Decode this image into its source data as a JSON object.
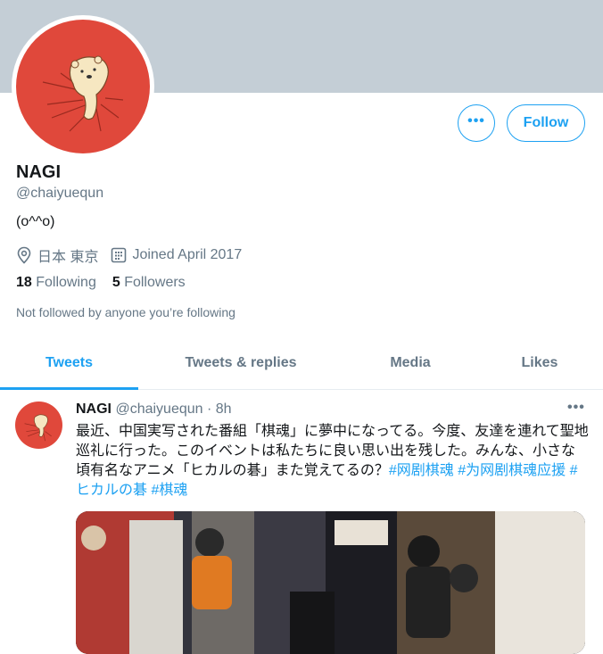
{
  "profile": {
    "name": "NAGI",
    "handle": "@chaiyuequn",
    "bio": "(o^^o)",
    "location": "日本 東京",
    "joined": "Joined April 2017",
    "following_count": "18",
    "following_label": "Following",
    "followers_count": "5",
    "followers_label": "Followers",
    "not_followed_note": "Not followed by anyone you’re following"
  },
  "actions": {
    "more_label": "•••",
    "follow_label": "Follow"
  },
  "tabs": [
    {
      "label": "Tweets",
      "active": true
    },
    {
      "label": "Tweets & replies"
    },
    {
      "label": "Media"
    },
    {
      "label": "Likes"
    }
  ],
  "tweet": {
    "name": "NAGI",
    "handle": "@chaiyuequn",
    "dot": "·",
    "time": "8h",
    "more_label": "•••",
    "text": "最近、中国実写された番組「棋魂」に夢中になってる。今度、友達を連れて聖地巡礼に行った。このイベントは私たちに良い思い出を残した。みんな、小さな頃有名なアニメ「ヒカルの碁」また覚えてるの？",
    "hashtags": [
      "#网剧棋魂",
      "#为网剧棋魂应援",
      "#ヒカルの碁",
      "#棋魂"
    ]
  },
  "colors": {
    "accent": "#1da1f2",
    "banner": "#c4ced6",
    "avatar_bg": "#e0483b",
    "muted": "#657786"
  },
  "icons": {
    "location": "location-pin-icon",
    "calendar": "calendar-icon"
  }
}
